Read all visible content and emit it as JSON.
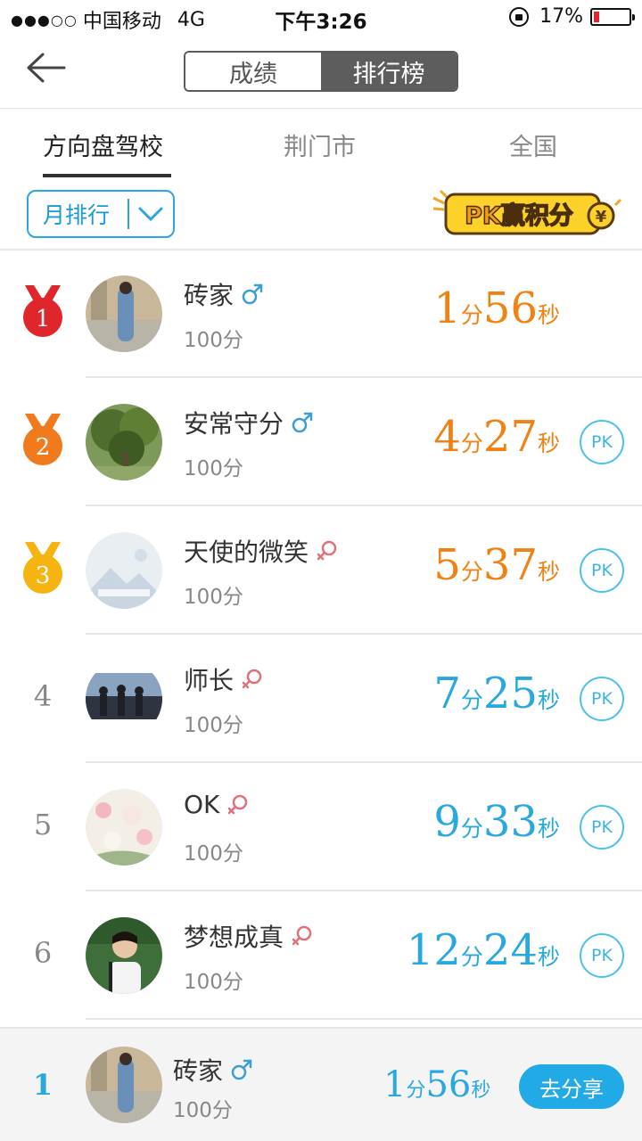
{
  "status_bar": {
    "signal": "●●●○○",
    "carrier": "中国移动",
    "network": "4G",
    "time": "下午3:26",
    "battery": "17%",
    "battery_level": 0.17
  },
  "header": {
    "tabs": [
      "成绩",
      "排行榜"
    ],
    "active_tab": "排行榜"
  },
  "scope_tabs": [
    {
      "label": "方向盘驾校",
      "active": true
    },
    {
      "label": "荆门市",
      "active": false
    },
    {
      "label": "全国",
      "active": false
    }
  ],
  "filter": {
    "label": "月排行"
  },
  "pk_banner": {
    "text": "PK赢积分",
    "currency": "¥"
  },
  "rankings": [
    {
      "rank": "1",
      "medal_color": "#e0262b",
      "name": "砖家",
      "gender": "male",
      "score": "100分",
      "min": "1",
      "min_unit": "分",
      "sec": "56",
      "sec_unit": "秒",
      "color": "orange",
      "pk": ""
    },
    {
      "rank": "2",
      "medal_color": "#f07a1c",
      "name": "安常守分",
      "gender": "male",
      "score": "100分",
      "min": "4",
      "min_unit": "分",
      "sec": "27",
      "sec_unit": "秒",
      "color": "orange",
      "pk": "PK"
    },
    {
      "rank": "3",
      "medal_color": "#f5b40f",
      "name": "天使的微笑",
      "gender": "female",
      "score": "100分",
      "min": "5",
      "min_unit": "分",
      "sec": "37",
      "sec_unit": "秒",
      "color": "orange",
      "pk": "PK"
    },
    {
      "rank": "4",
      "medal_color": "",
      "name": "师长",
      "gender": "female",
      "score": "100分",
      "min": "7",
      "min_unit": "分",
      "sec": "25",
      "sec_unit": "秒",
      "color": "blue",
      "pk": "PK"
    },
    {
      "rank": "5",
      "medal_color": "",
      "name": "OK",
      "gender": "female",
      "score": "100分",
      "min": "9",
      "min_unit": "分",
      "sec": "33",
      "sec_unit": "秒",
      "color": "blue",
      "pk": "PK"
    },
    {
      "rank": "6",
      "medal_color": "",
      "name": "梦想成真",
      "gender": "female",
      "score": "100分",
      "min": "12",
      "min_unit": "分",
      "sec": "24",
      "sec_unit": "秒",
      "color": "blue",
      "pk": "PK"
    }
  ],
  "my_rank": {
    "rank": "1",
    "name": "砖家",
    "gender": "male",
    "score": "100分",
    "min": "1",
    "min_unit": "分",
    "sec": "56",
    "sec_unit": "秒",
    "share_label": "去分享"
  },
  "colors": {
    "accent_blue": "#29a8e0",
    "accent_orange": "#f08214",
    "male": "#3b9fd6",
    "female": "#e0707a"
  }
}
